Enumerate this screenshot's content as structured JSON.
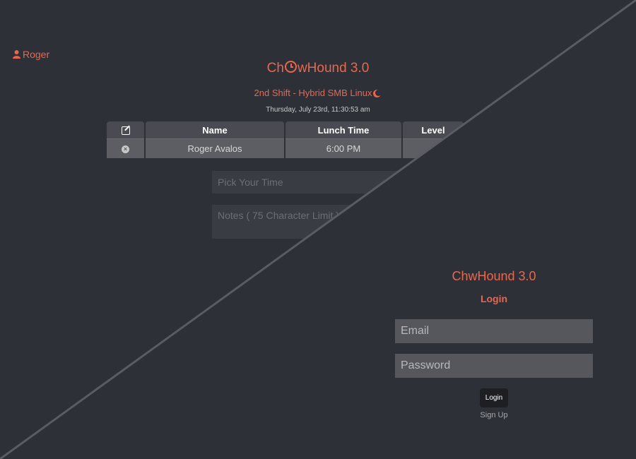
{
  "user": {
    "name": "Roger"
  },
  "app": {
    "title": "ChOwHound 3.0",
    "title_pre": "Ch",
    "title_post": "wHound 3.0",
    "shift": "2nd Shift - Hybrid SMB Linux",
    "datetime": "Thursday, July 23rd, 11:30:53 am"
  },
  "table": {
    "headers": {
      "name": "Name",
      "lunch_time": "Lunch Time",
      "level": "Level"
    },
    "rows": [
      {
        "name": "Roger Avalos",
        "lunch_time": "6:00 PM",
        "level": ""
      }
    ]
  },
  "form": {
    "time_placeholder": "Pick Your Time",
    "notes_placeholder": "Notes ( 75 Character Limit )"
  },
  "login": {
    "title": "ChwHound 3.0",
    "subtitle": "Login",
    "email_placeholder": "Email",
    "password_placeholder": "Password",
    "button_label": "Login",
    "signup_label": "Sign Up"
  },
  "colors": {
    "accent": "#e8674f",
    "background": "#2e3038"
  },
  "icons": {
    "user": "user-icon",
    "edit": "edit-icon",
    "remove": "remove-icon",
    "clock": "clock-icon",
    "moon": "moon-icon"
  }
}
